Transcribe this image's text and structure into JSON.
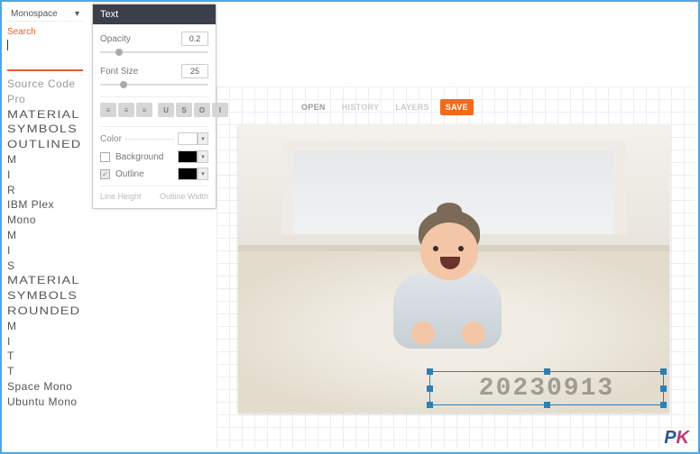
{
  "sidebar": {
    "selected_family": "Monospace",
    "search_label": "Search",
    "search_value": "",
    "font_rows": [
      "Source Code",
      "Pro",
      "MATERIAL",
      "SYMBOLS",
      "OUTLINED",
      "M",
      " I",
      "  R",
      " IBM Plex",
      "  Mono",
      "M",
      " I",
      "  S",
      "MATERIAL",
      "SYMBOLS",
      "ROUNDED",
      "M",
      " I",
      "  T",
      "   T",
      "Space Mono",
      "Ubuntu Mono"
    ]
  },
  "panel": {
    "title": "Text",
    "opacity_label": "Opacity",
    "opacity_value": "0.2",
    "font_size_label": "Font Size",
    "font_size_value": "25",
    "align_icons": [
      "align-left",
      "align-center",
      "align-right"
    ],
    "style_icons": [
      "U",
      "S",
      "O",
      "I"
    ],
    "color_label": "Color",
    "color_value": "#1d3b36",
    "background_label": "Background",
    "background_checked": false,
    "background_swatch": "#000000",
    "outline_label": "Outline",
    "outline_checked": true,
    "outline_swatch": "#000000",
    "line_height_label": "Line Height",
    "outline_width_label": "Outline Width"
  },
  "toolbar": {
    "open": "OPEN",
    "history": "HISTORY",
    "layers": "LAYERS",
    "save": "SAVE"
  },
  "canvas": {
    "overlay_text": "20230913"
  },
  "watermark": {
    "p": "P",
    "k": "K"
  }
}
